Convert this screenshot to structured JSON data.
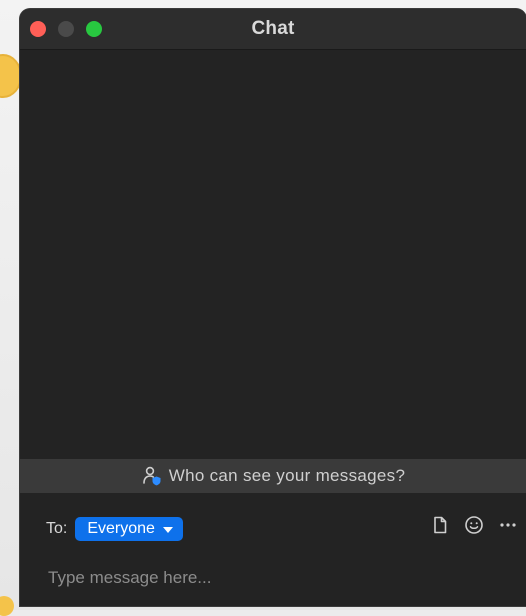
{
  "window": {
    "title": "Chat",
    "controls": {
      "close_color": "#ff5f57",
      "minimize_color": "#4a4a4a",
      "zoom_color": "#28c840"
    }
  },
  "visibility_notice": {
    "icon": "person-shield-icon",
    "text": "Who can see your messages?"
  },
  "composer": {
    "to_label": "To:",
    "recipient": "Everyone",
    "recipient_color": "#0e71eb",
    "placeholder": "Type message here...",
    "tools": [
      "file-icon",
      "emoji-icon",
      "more-icon"
    ]
  }
}
